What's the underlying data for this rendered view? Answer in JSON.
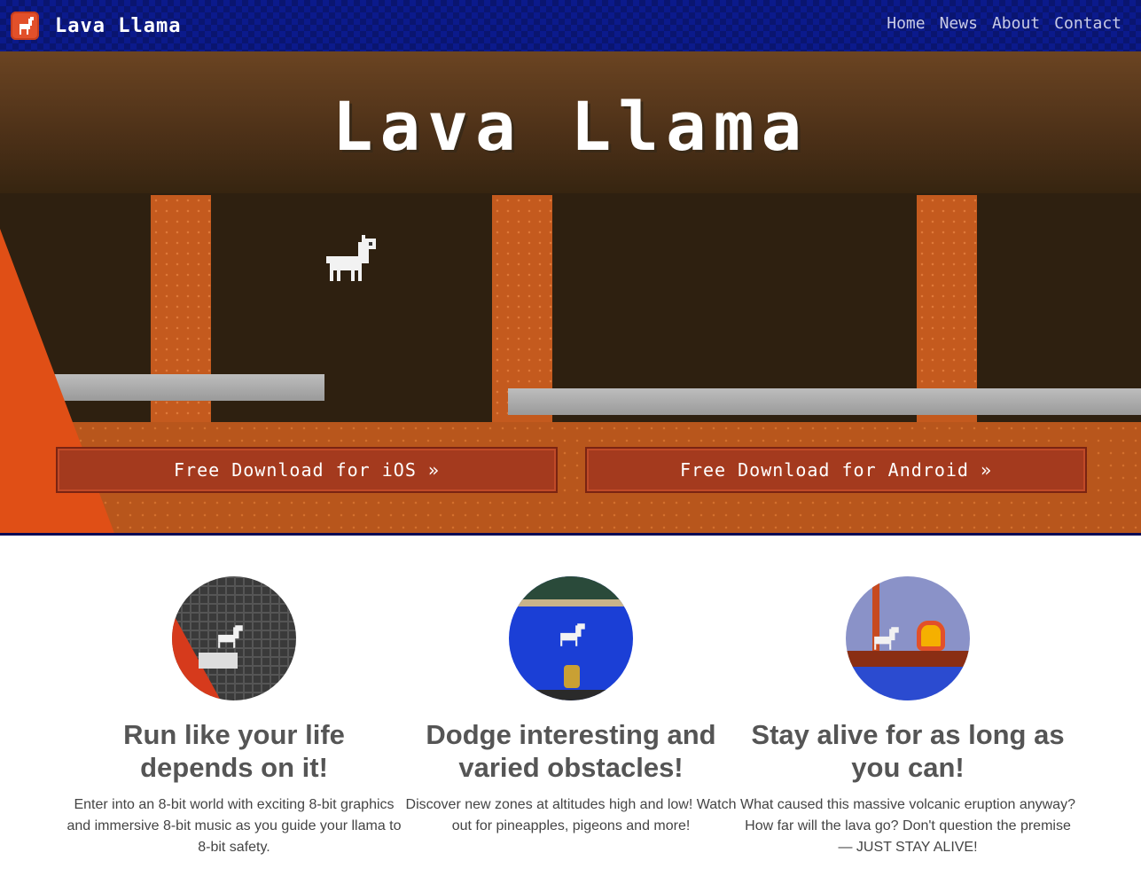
{
  "navbar": {
    "brand": "Lava Llama",
    "links": [
      "Home",
      "News",
      "About",
      "Contact"
    ]
  },
  "hero": {
    "title": "Lava Llama",
    "ios_button": "Free Download for iOS »",
    "android_button": "Free Download for Android »"
  },
  "features": [
    {
      "title": "Run like your life depends on it!",
      "text": "Enter into an 8-bit world with exciting 8-bit graphics and immersive 8-bit music as you guide your llama to 8-bit safety."
    },
    {
      "title": "Dodge interesting and varied obstacles!",
      "text": "Discover new zones at altitudes high and low! Watch out for pineapples, pigeons and more!"
    },
    {
      "title": "Stay alive for as long as you can!",
      "text": "What caused this massive volcanic eruption anyway? How far will the lava go? Don't question the premise — JUST STAY ALIVE!"
    }
  ],
  "icons": {
    "brand": "llama-logo-icon",
    "hero_sprite": "llama-sprite-icon"
  },
  "colors": {
    "nav_bg": "#0b1a8c",
    "button_bg": "#a43a1e",
    "lava": "#e04f16"
  }
}
